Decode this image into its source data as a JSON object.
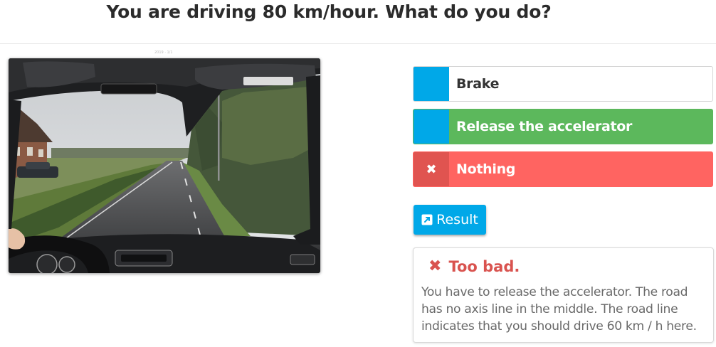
{
  "question": "You are driving 80 km/hour. What do you do?",
  "photo": {
    "caption": "2019 · 1/1"
  },
  "answers": [
    {
      "label": "Brake",
      "state": "neutral",
      "marker": ""
    },
    {
      "label": "Release the accelerator",
      "state": "correct",
      "marker": ""
    },
    {
      "label": "Nothing",
      "state": "wrong",
      "marker": "✖"
    }
  ],
  "result_button": {
    "label": "Result",
    "icon": "external-link-icon"
  },
  "feedback": {
    "icon": "✖",
    "title": "Too bad.",
    "text": "You have to release the accelerator. The road has no axis line in the middle. The road line indicates that you should drive 60 km / h here."
  },
  "colors": {
    "accent": "#00a8e8",
    "correct": "#5cb85c",
    "wrong": "#ff6461",
    "wrong_marker": "#e05450",
    "error_text": "#d9534f"
  }
}
